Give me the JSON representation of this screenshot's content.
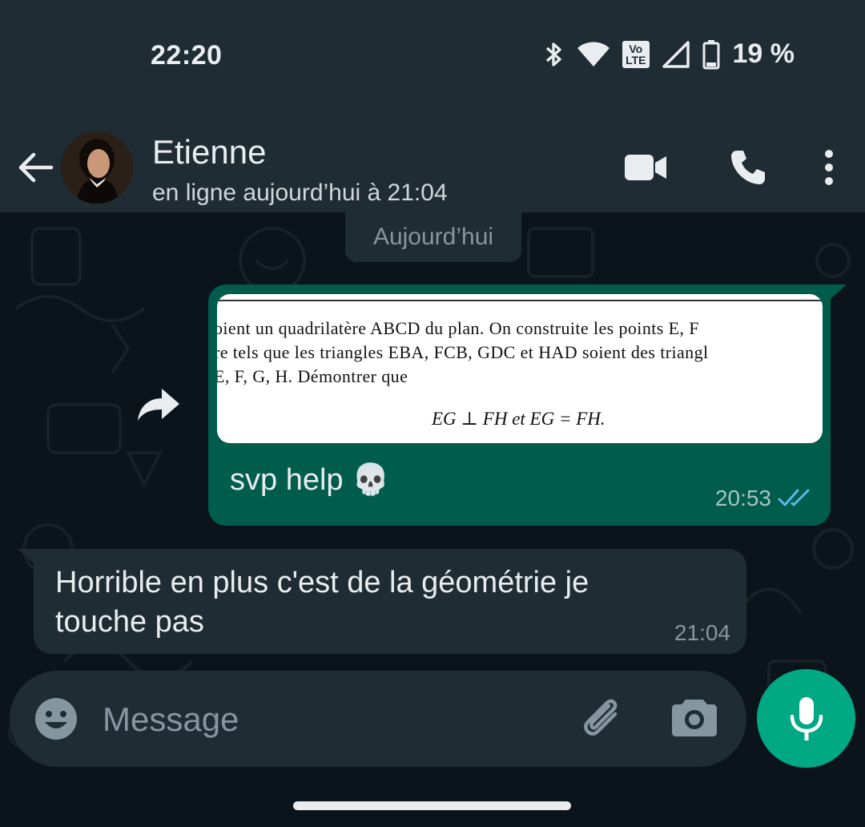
{
  "status_bar": {
    "time": "22:20",
    "volte_label": "Vo\nLTE",
    "battery": "19 %",
    "icons": [
      "bluetooth-icon",
      "wifi-icon",
      "volte-icon",
      "signal-icon",
      "battery-icon"
    ]
  },
  "header": {
    "contact_name": "Etienne",
    "contact_status": "en ligne aujourd’hui à 21:04",
    "actions": [
      "video-call-icon",
      "phone-icon",
      "more-options-icon"
    ]
  },
  "chat": {
    "date_chip": "Aujourd’hui",
    "messages": [
      {
        "direction": "outgoing",
        "image_text": {
          "line1": "oient un quadrilatère ABCD du plan. On construite les points E, F",
          "line2": "re tels que les triangles EBA, FCB, GDC et HAD soient des triangl",
          "line3": "E, F, G, H. Démontrer que",
          "formula": "EG ⊥ FH   et   EG = FH."
        },
        "text": "svp help 💀",
        "time": "20:53",
        "read_status": "read"
      },
      {
        "direction": "incoming",
        "text": "Horrible en plus c'est de la géométrie je touche pas",
        "time": "21:04"
      }
    ]
  },
  "composer": {
    "placeholder": "Message"
  },
  "colors": {
    "app_bar": "#1f2c34",
    "background": "#0b141a",
    "outgoing_bubble": "#005c4b",
    "incoming_bubble": "#1f2c34",
    "accent": "#00a884",
    "read_ticks": "#53bdeb"
  }
}
